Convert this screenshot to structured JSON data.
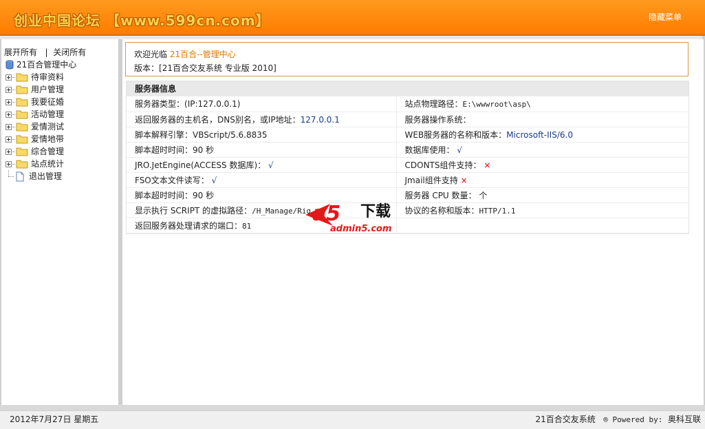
{
  "header": {
    "logo_text": "创业中国论坛 【www.599cn.com】",
    "hide_menu": "隐藏菜单",
    "brand_color": "#ff8400"
  },
  "sidebar": {
    "expand_all": "展开所有",
    "separator": "|",
    "collapse_all": "关闭所有",
    "root": "21百合管理中心",
    "items": [
      {
        "label": "待审资料"
      },
      {
        "label": "用户管理"
      },
      {
        "label": "我要征婚"
      },
      {
        "label": "活动管理"
      },
      {
        "label": "爱情测试"
      },
      {
        "label": "爱情地带"
      },
      {
        "label": "综合管理"
      },
      {
        "label": "站点统计"
      }
    ],
    "logout": "退出管理"
  },
  "welcome": {
    "greeting": "欢迎光临",
    "site": "21百合--管理中心",
    "version_label": "版本：",
    "version": "[21百合交友系统 专业版 2010]"
  },
  "server_info": {
    "title": "服务器信息",
    "rows": [
      {
        "l_label": "服务器类型：",
        "l_value": "(IP:127.0.0.1)",
        "r_label": "站点物理路径：",
        "r_value": "E:\\wwwroot\\asp\\"
      },
      {
        "l_label": "返回服务器的主机名，DNS别名，或IP地址：",
        "l_value": "127.0.0.1",
        "r_label": "服务器操作系统：",
        "r_value": ""
      },
      {
        "l_label": "脚本解释引擎：",
        "l_value": "VBScript/5.6.8835",
        "r_label": "WEB服务器的名称和版本：",
        "r_value": "Microsoft-IIS/6.0"
      },
      {
        "l_label": "脚本超时时间：",
        "l_value": "90 秒",
        "r_label": "数据库使用：",
        "r_value": "√"
      },
      {
        "l_label": "JRO.JetEngine(ACCESS 数据库)：",
        "l_value": "√",
        "r_label": "CDONTS组件支持：",
        "r_value": "×"
      },
      {
        "l_label": "FSO文本文件读写：",
        "l_value": "√",
        "r_label": "Jmail组件支持",
        "r_value": "×"
      },
      {
        "l_label": "脚本超时时间：",
        "l_value": "90 秒",
        "r_label": "服务器 CPU 数量：",
        "r_value": "个"
      },
      {
        "l_label": "显示执行 SCRIPT 的虚拟路径：",
        "l_value": "/H_Manage/Rig",
        "r_label": "协议的名称和版本：",
        "r_value": "HTTP/1.1"
      },
      {
        "l_label": "返回服务器处理请求的端口：",
        "l_value": "81",
        "r_label": "",
        "r_value": ""
      }
    ]
  },
  "watermark": {
    "logo": "a5",
    "text": "下载",
    "domain": "admin5.com"
  },
  "footer": {
    "date": "2012年7月27日 星期五",
    "system": "21百合交友系统",
    "powered": "® Powered by:",
    "company": "奥科互联"
  }
}
